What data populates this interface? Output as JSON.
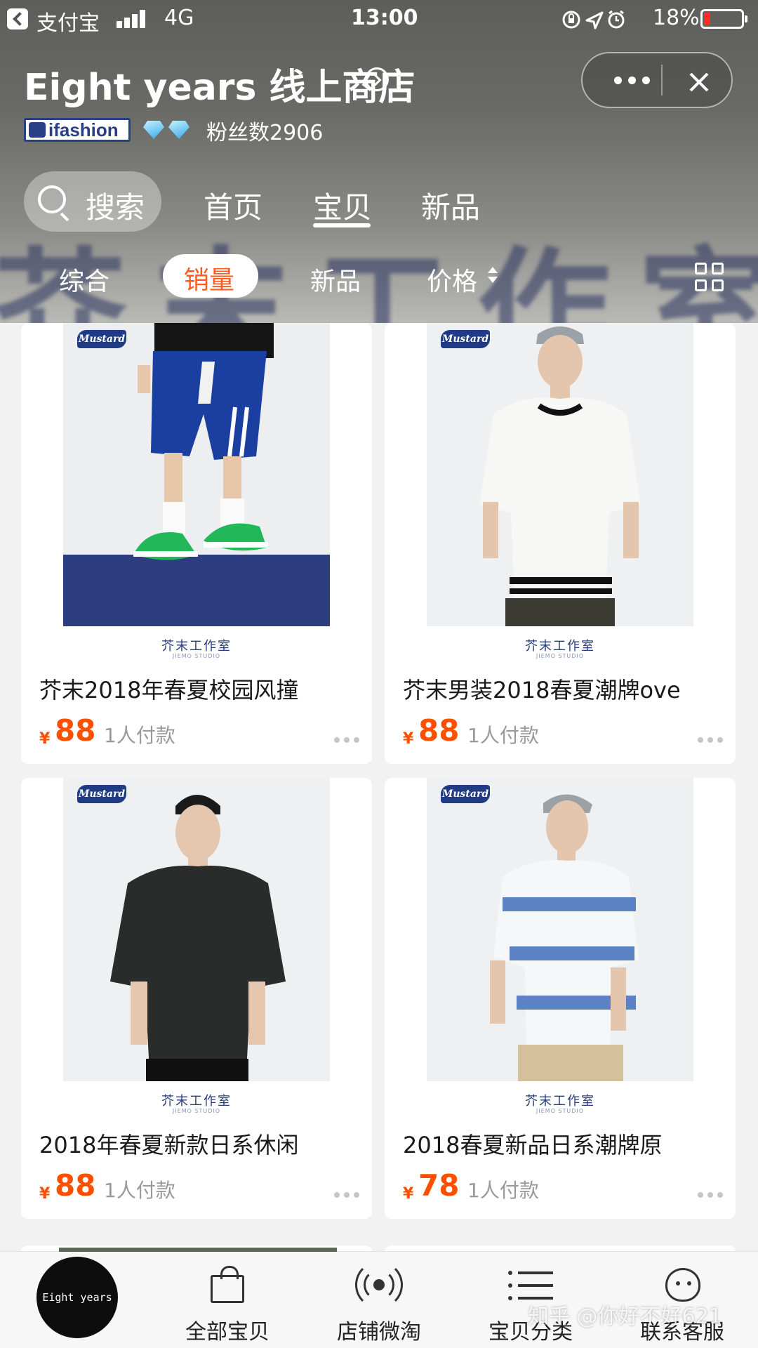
{
  "status_bar": {
    "carrier": "支付宝",
    "network": "4G",
    "time": "13:00",
    "battery_percent": "18%",
    "battery_level": 0.18,
    "icons": [
      "lock-rotation-icon",
      "location-arrow-icon",
      "alarm-icon"
    ]
  },
  "store": {
    "name": "Eight years 线上商店",
    "badge": "ifashion",
    "diamond_count": 2,
    "fans_label": "粉丝数2906",
    "banner_text": "芥末工作室"
  },
  "nav": {
    "search_label": "搜索",
    "tabs": [
      {
        "label": "首页",
        "active": false
      },
      {
        "label": "宝贝",
        "active": true
      },
      {
        "label": "新品",
        "active": false
      }
    ]
  },
  "sort": {
    "items": [
      {
        "label": "综合",
        "active": false
      },
      {
        "label": "销量",
        "active": true
      },
      {
        "label": "新品",
        "active": false
      },
      {
        "label": "价格",
        "active": false
      }
    ]
  },
  "products": [
    {
      "title": "芥末2018年春夏校园风撞",
      "currency": "¥",
      "price": "88",
      "sold": "1人付款",
      "brand_tag": "Mustard",
      "studio": "芥末工作室",
      "studio_sub": "JIEMO STUDIO"
    },
    {
      "title": "芥末男装2018春夏潮牌ove",
      "currency": "¥",
      "price": "88",
      "sold": "1人付款",
      "brand_tag": "Mustard",
      "studio": "芥末工作室",
      "studio_sub": "JIEMO STUDIO"
    },
    {
      "title": "2018年春夏新款日系休闲",
      "currency": "¥",
      "price": "88",
      "sold": "1人付款",
      "brand_tag": "Mustard",
      "studio": "芥末工作室",
      "studio_sub": "JIEMO STUDIO"
    },
    {
      "title": "2018春夏新品日系潮牌原",
      "currency": "¥",
      "price": "78",
      "sold": "1人付款",
      "brand_tag": "Mustard",
      "studio": "芥末工作室",
      "studio_sub": "JIEMO STUDIO"
    }
  ],
  "tabbar": {
    "shop_logo_text": "Eight years",
    "items": [
      {
        "label": "全部宝贝",
        "icon": "shopping-bag-icon"
      },
      {
        "label": "店铺微淘",
        "icon": "broadcast-icon"
      },
      {
        "label": "宝贝分类",
        "icon": "list-icon"
      },
      {
        "label": "联系客服",
        "icon": "service-face-icon"
      }
    ]
  },
  "watermark": "知乎 @你好不好621",
  "colors": {
    "accent_orange": "#ff5000",
    "active_sort_text": "#ff5a1f",
    "brand_navy": "#2b3f86",
    "battery_low": "#ff2a2a"
  }
}
